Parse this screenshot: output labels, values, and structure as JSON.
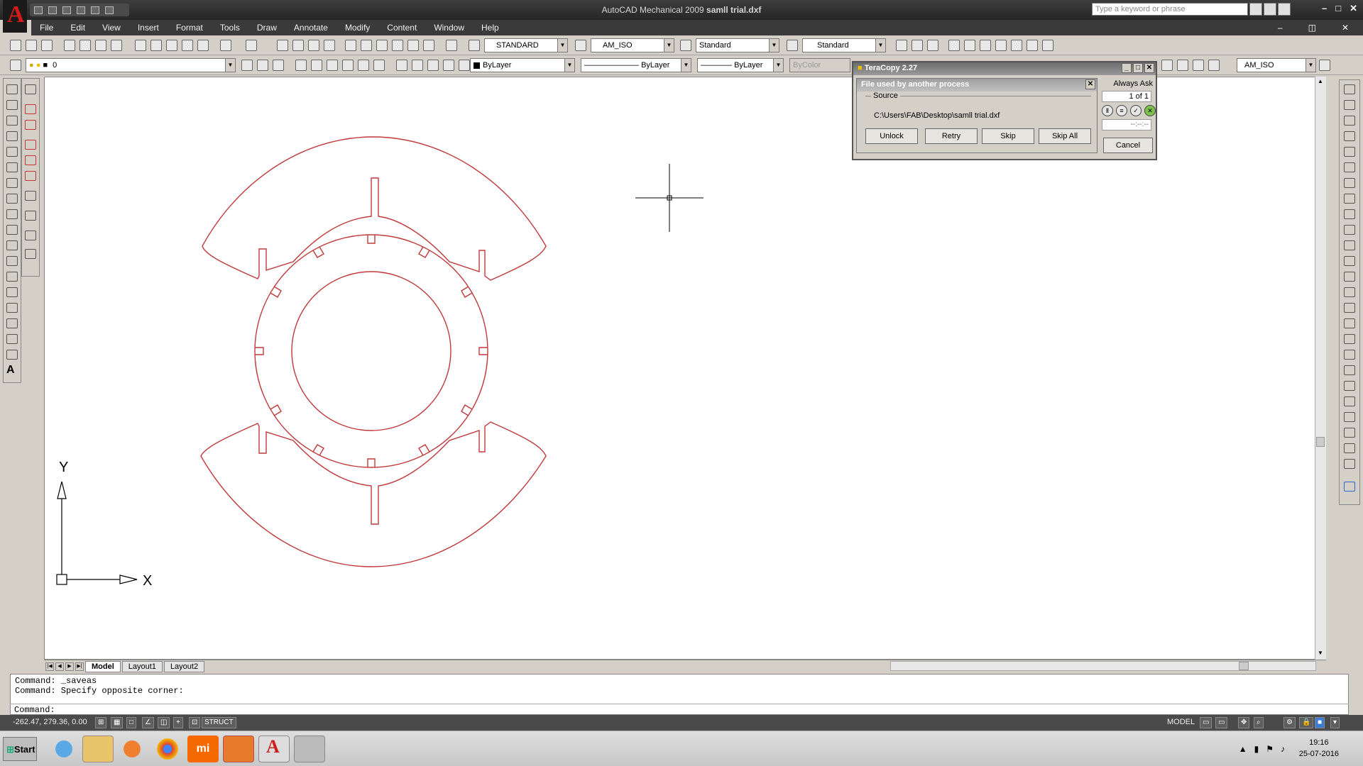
{
  "window": {
    "title": "AutoCAD Mechanical 2009",
    "file": "samll trial.dxf",
    "search_placeholder": "Type a keyword or phrase",
    "controls": [
      "–",
      "□",
      "✕"
    ],
    "doc_controls": [
      "–",
      "◫",
      "✕"
    ]
  },
  "menu": [
    "File",
    "Edit",
    "View",
    "Insert",
    "Format",
    "Tools",
    "Draw",
    "Annotate",
    "Modify",
    "Content",
    "Window",
    "Help"
  ],
  "toolbar1": {
    "text_style": "STANDARD",
    "dim_style": "AM_ISO",
    "table_style": "Standard",
    "mleader_style": "Standard"
  },
  "toolbar2": {
    "layer": "0",
    "color": "ByLayer",
    "linetype": "ByLayer",
    "lineweight": "ByLayer",
    "plotstyle": "ByColor",
    "dim_style2": "AM_ISO"
  },
  "layout_tabs": [
    "Model",
    "Layout1",
    "Layout2"
  ],
  "command": {
    "history": [
      "Command: _saveas",
      "Command: Specify opposite corner:"
    ],
    "prompt": "Command:"
  },
  "status": {
    "coords": "-262.47, 279.36, 0.00",
    "struct": "STRUCT",
    "model": "MODEL"
  },
  "ucs": {
    "x_label": "X",
    "y_label": "Y"
  },
  "teracopy": {
    "title": "TeraCopy 2.27",
    "inner_title": "File used by another process",
    "source_label": "Source",
    "path": "C:\\Users\\FAB\\Desktop\\samll trial.dxf",
    "buttons": [
      "Unlock",
      "Retry",
      "Skip",
      "Skip All"
    ],
    "always_ask": "Always Ask",
    "counter": "1 of 1",
    "time": "--:--:--",
    "cancel": "Cancel"
  },
  "taskbar": {
    "start": "Start",
    "time": "19:16",
    "date": "25-07-2016"
  },
  "colors": {
    "drawing_line": "#c0393b",
    "cad_red": "#d41b1b"
  }
}
